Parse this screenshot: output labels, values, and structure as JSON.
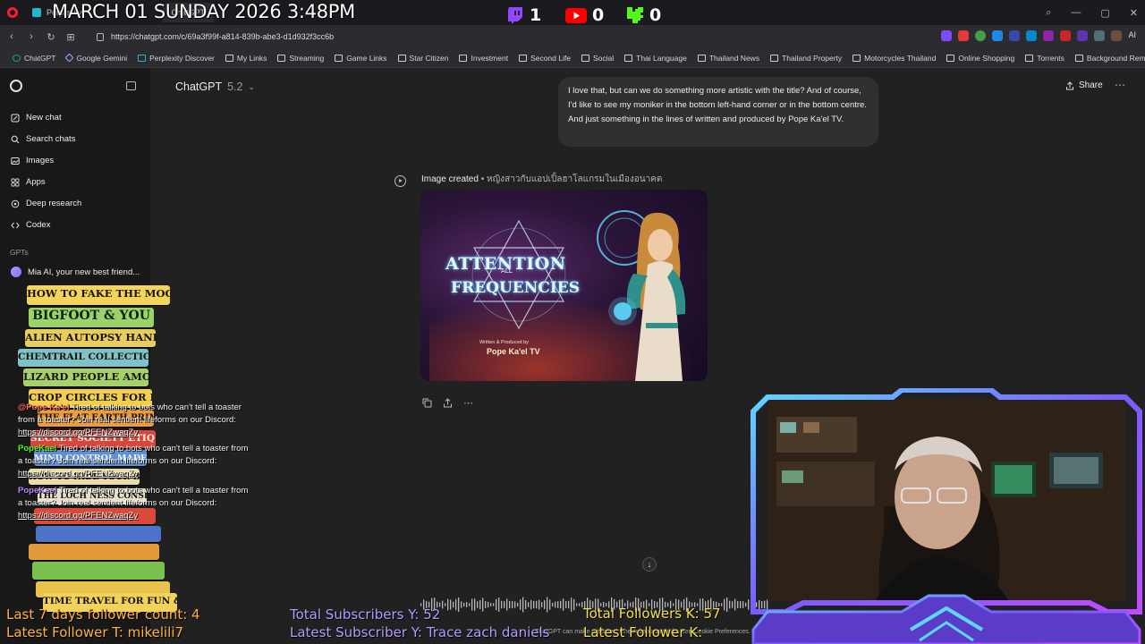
{
  "browser": {
    "tabs": [
      {
        "label": "Perplexity",
        "active": false
      },
      {
        "label": "ChatGPT",
        "active": true
      }
    ],
    "url": "https://chatgpt.com/c/69a3f99f-a814-839b-abe3-d1d932f3cc6b",
    "bookmarks": [
      "ChatGPT",
      "Google Gemini",
      "Perplexity Discover",
      "My Links",
      "Streaming",
      "Game Links",
      "Star Citizen",
      "Investment",
      "Second Life",
      "Social",
      "Thai Language",
      "Thailand News",
      "Thailand Property",
      "Motorcycles Thailand",
      "Online Shopping",
      "Torrents",
      "Background Remover"
    ],
    "ai_label": "AI"
  },
  "sidebar": {
    "items": [
      {
        "label": "New chat",
        "icon": "edit-icon"
      },
      {
        "label": "Search chats",
        "icon": "search-icon"
      },
      {
        "label": "Images",
        "icon": "image-icon"
      },
      {
        "label": "Apps",
        "icon": "apps-icon"
      },
      {
        "label": "Deep research",
        "icon": "research-icon"
      },
      {
        "label": "Codex",
        "icon": "codex-icon"
      }
    ],
    "section_label": "GPTs",
    "gpt_item": "Mia AI, your new best friend..."
  },
  "main": {
    "model_name": "ChatGPT",
    "model_version": "5.2",
    "share_label": "Share",
    "user_message": "I love that, but can we do something more artistic with the title? And of course, I'd like to see my moniker in the bottom left-hand corner or in the bottom centre. And just something in the lines of written and produced by Pope Ka'el TV.",
    "image_created_label": "Image created",
    "image_created_sep": " • ",
    "image_caption": "หญิงสาวกับแอปเปิ้ลฮาโลแกรมในเมืองอนาคต",
    "image": {
      "title_line1": "ATTENTION",
      "title_small": "ALL",
      "title_line2": "FREQUENCIES",
      "credit_small": "Written & Produced by",
      "credit": "Pope Ka'el TV"
    },
    "footer_note": "ChatGPT can make mistakes. Check important info. See Cookie Preferences."
  },
  "overlay": {
    "clock": "MARCH 01 SUNDAY 2026 3:48PM",
    "twitch_count": "1",
    "youtube_count": "0",
    "kick_count": "0",
    "bottom_left_line1": "Last 7 days follower count: 4",
    "bottom_left_line2": "Latest Follower T: mikelili7",
    "bottom_mid_line1": "Total Subscribers Y: 52",
    "bottom_mid_line2": "Latest Subscriber Y: Trace zach daniels",
    "bottom_right_line1": "Total Followers K: 57",
    "bottom_right_line2": "Latest Follower K:",
    "books": [
      "HOW TO FAKE THE MOON LANDING",
      "BIGFOOT & YOU",
      "ALIEN AUTOPSY HANDBOOK",
      "CHEMTRAIL COLLECTION GUIDE",
      "LIZARD PEOPLE AMONG US",
      "CROP CIRCLES FOR DUMMIES",
      "THE FLAT EARTH PRIMER",
      "SECRET SOCIETY ETIQUETTE",
      "MIND CONTROL MADE EASY",
      "HOW TO HIDE YOUR BUNKER",
      "THE LOCH NESS CONSPIRACY",
      "TIME TRAVEL FOR FUN & PROFIT"
    ],
    "chat_messages": [
      {
        "user": "@Pope Ka'el",
        "text": "Tired of talking to bots who can't tell a toaster from a toaster? Join real sentient lifeforms on our Discord:",
        "link": "https://discord.gg/PFENZwaqZy",
        "color": "#ff4040"
      },
      {
        "user": "PopeKael",
        "text": "Tired of talking to bots who can't tell a toaster from a toaster? Join real sentient lifeforms on our Discord:",
        "link": "https://discord.gg/PFENZwaqZy",
        "color": "#53fc18"
      },
      {
        "user": "PopeKael",
        "text": "Tired of talking to bots who can't tell a toaster from a toaster? Join real sentient lifeforms on our Discord:",
        "link": "https://discord.gg/PFENZwaqZy",
        "color": "#9146ff"
      }
    ]
  }
}
